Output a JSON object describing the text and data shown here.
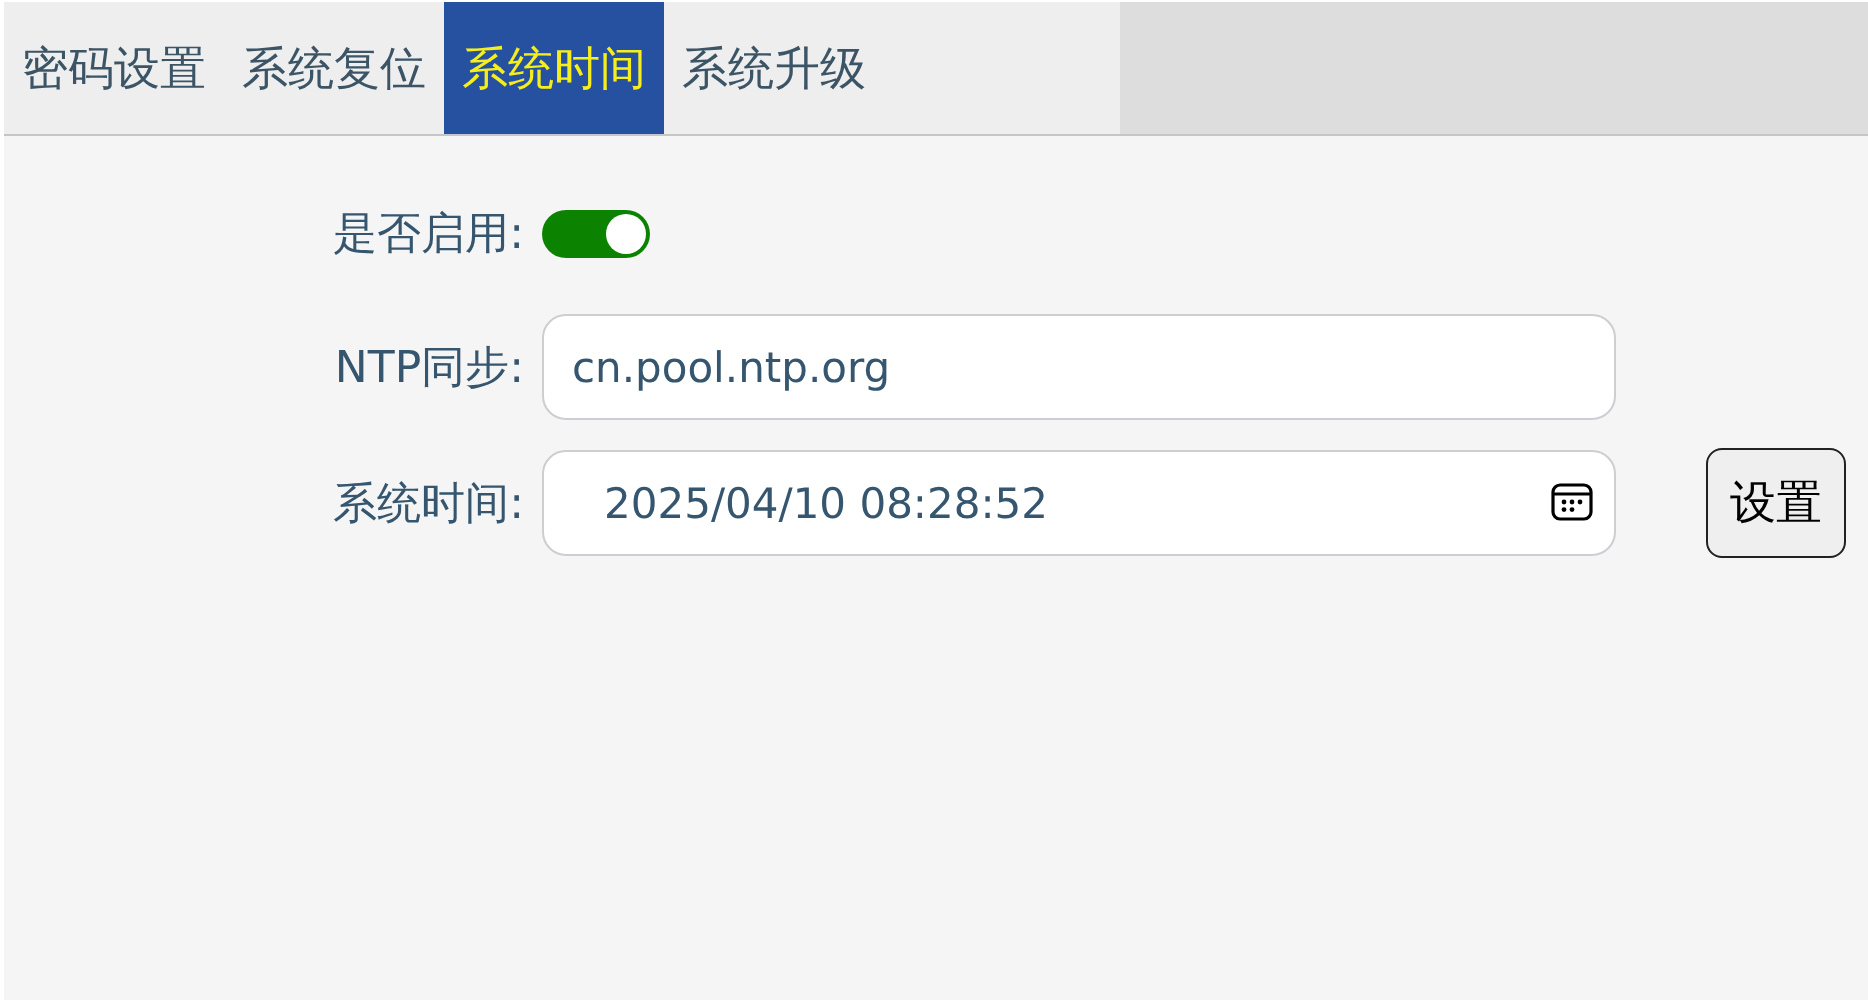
{
  "tabs": [
    {
      "label": "密码设置",
      "selected": false
    },
    {
      "label": "系统复位",
      "selected": false
    },
    {
      "label": "系统时间",
      "selected": true
    },
    {
      "label": "系统升级",
      "selected": false
    }
  ],
  "form": {
    "enable": {
      "label": "是否启用:",
      "on": true
    },
    "ntp": {
      "label": "NTP同步:",
      "value": "cn.pool.ntp.org"
    },
    "time": {
      "label": "系统时间:",
      "value": "2025/04/10 08:28:52"
    },
    "set_button": "设置"
  }
}
